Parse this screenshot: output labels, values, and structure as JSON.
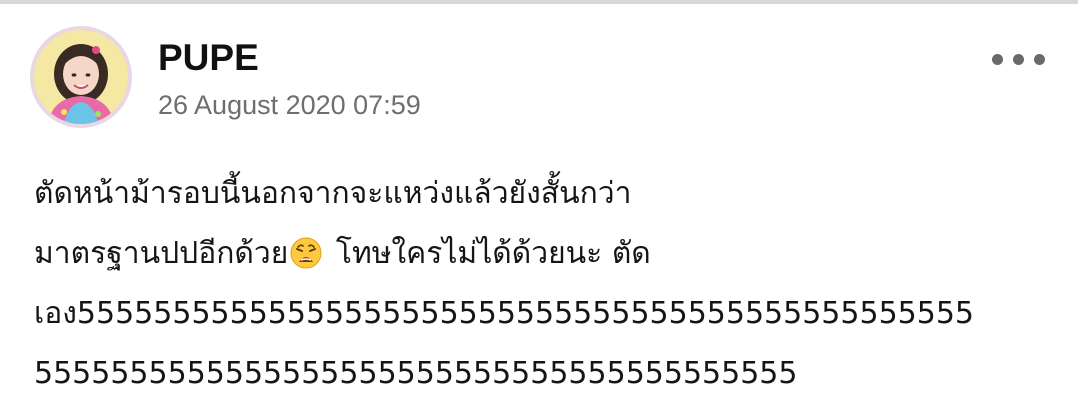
{
  "post": {
    "author": {
      "name": "PUPE",
      "avatar": "profile-photo"
    },
    "timestamp": "26 August 2020 07:59",
    "more_icon": "more-horizontal-icon",
    "text": {
      "line1": "ตัดหน้าม้ารอบนี้นอกจากจะแหว่งแล้วยังสั้นกว่า",
      "line2_a": "มาตรฐานปปอีกด้วย",
      "line2_emoji": "weary-face-emoji",
      "line2_b": " โทษใครไม่ได้ด้วยนะ ตัด",
      "line3": "เอง55555555555555555555555555555555555555555555555",
      "line4": "5555555555555555555555555555555555555555"
    }
  },
  "colors": {
    "divider": "#d8d8d8",
    "username": "#111111",
    "timestamp": "#6e6e6e",
    "text": "#151515",
    "more_dots": "#6a6a6a"
  }
}
